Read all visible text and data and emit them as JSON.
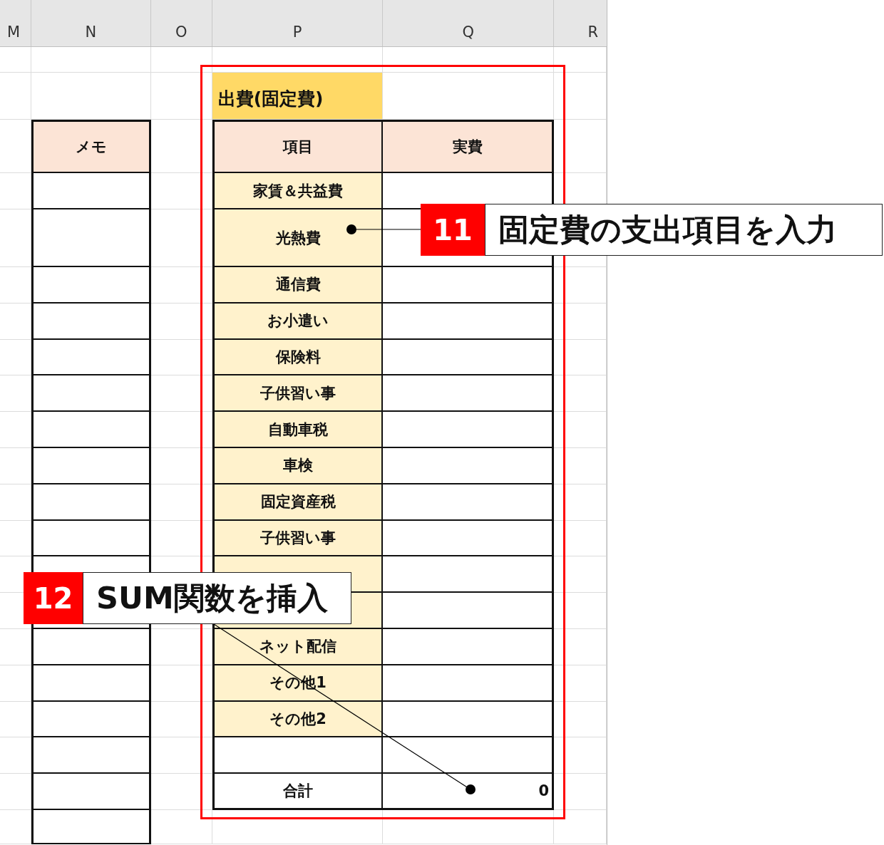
{
  "columns": [
    "M",
    "N",
    "O",
    "P",
    "Q",
    "R"
  ],
  "title": "出費(固定費)",
  "memo_header": "メモ",
  "table_headers": [
    "項目",
    "実費"
  ],
  "items": [
    {
      "kind": "item",
      "label": "家賃＆共益費"
    },
    {
      "kind": "tall",
      "label": "光熱費"
    },
    {
      "kind": "item",
      "label": "通信費"
    },
    {
      "kind": "item",
      "label": "お小遣い"
    },
    {
      "kind": "item",
      "label": "保険料"
    },
    {
      "kind": "item",
      "label": "子供習い事"
    },
    {
      "kind": "item",
      "label": "自動車税"
    },
    {
      "kind": "item",
      "label": "車検"
    },
    {
      "kind": "item",
      "label": "固定資産税"
    },
    {
      "kind": "item",
      "label": "子供習い事"
    },
    {
      "kind": "covered"
    },
    {
      "kind": "covered"
    },
    {
      "kind": "item",
      "label": "ネット配信"
    },
    {
      "kind": "item",
      "label": "その他1"
    },
    {
      "kind": "item",
      "label": "その他2"
    },
    {
      "kind": "blank"
    }
  ],
  "total": {
    "label": "合計",
    "value": "0"
  },
  "callouts": [
    {
      "number": "11",
      "text": "固定費の支出項目を入力"
    },
    {
      "number": "12",
      "text": "SUM関数を挿入"
    }
  ]
}
